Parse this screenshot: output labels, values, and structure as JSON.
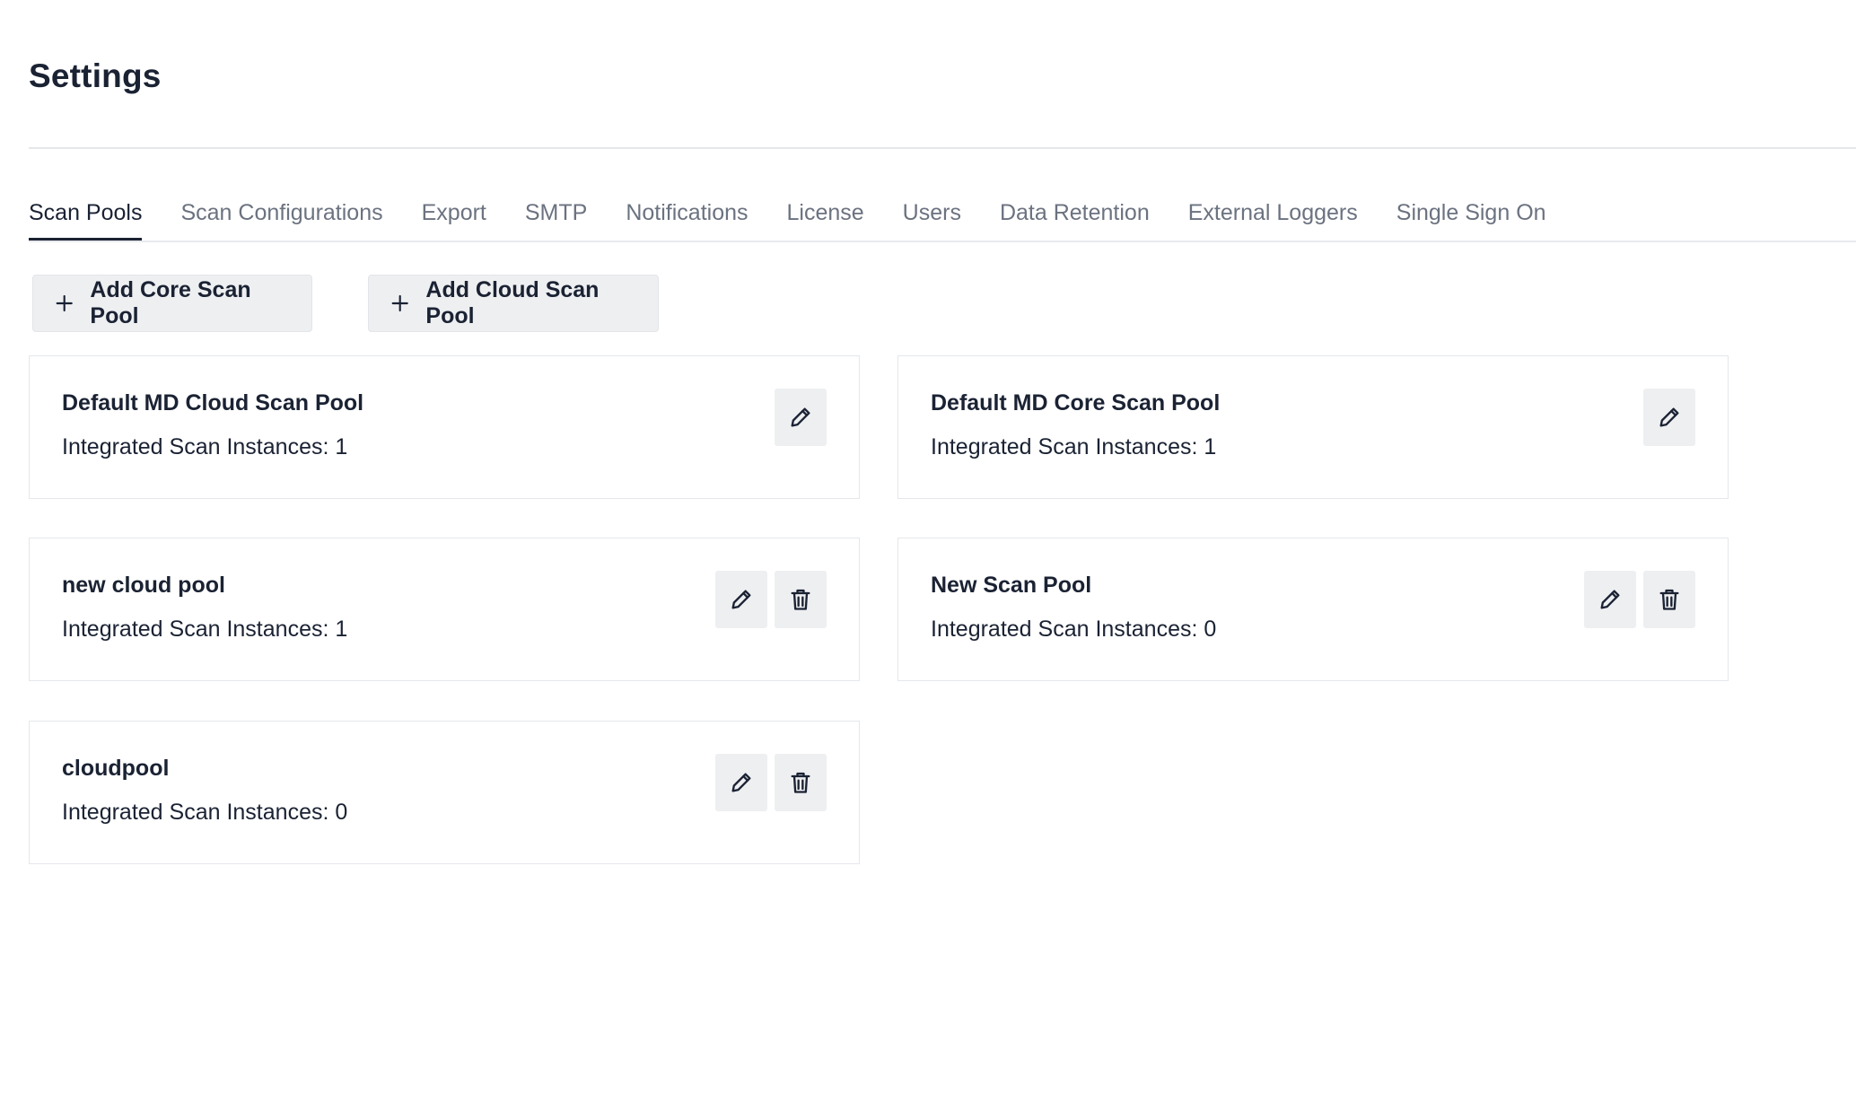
{
  "page": {
    "title": "Settings"
  },
  "tabs": [
    {
      "label": "Scan Pools",
      "active": true
    },
    {
      "label": "Scan Configurations"
    },
    {
      "label": "Export"
    },
    {
      "label": "SMTP"
    },
    {
      "label": "Notifications"
    },
    {
      "label": "License"
    },
    {
      "label": "Users"
    },
    {
      "label": "Data Retention"
    },
    {
      "label": "External Loggers"
    },
    {
      "label": "Single Sign On"
    }
  ],
  "toolbar": {
    "add_core_label": "Add Core Scan Pool",
    "add_cloud_label": "Add Cloud Scan Pool",
    "add_icon": "plus-icon"
  },
  "pools": [
    {
      "name": "Default MD Cloud Scan Pool",
      "instances_label": "Integrated Scan Instances: 1",
      "deletable": false
    },
    {
      "name": "Default MD Core Scan Pool",
      "instances_label": "Integrated Scan Instances: 1",
      "deletable": false
    },
    {
      "name": "new cloud pool",
      "instances_label": "Integrated Scan Instances: 1",
      "deletable": true
    },
    {
      "name": "New Scan Pool",
      "instances_label": "Integrated Scan Instances: 0",
      "deletable": true
    },
    {
      "name": "cloudpool",
      "instances_label": "Integrated Scan Instances: 0",
      "deletable": true
    }
  ],
  "icons": {
    "edit": "pencil-icon",
    "delete": "trash-icon"
  },
  "colors": {
    "text_dark": "#1a2233",
    "tab_inactive": "#6b7280",
    "button_bg": "#eeeff1",
    "border": "#e5e7eb"
  }
}
